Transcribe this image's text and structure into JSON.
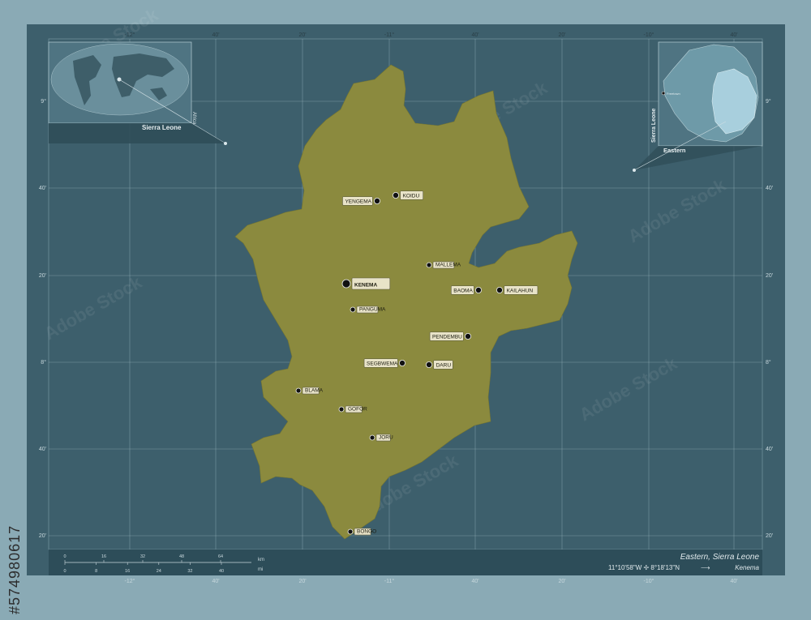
{
  "region": {
    "name": "Eastern, Sierra Leone",
    "coordinates": "11°10'58\"W ✢ 8°18'13\"N",
    "arrow": "⟶",
    "capital": "Kenema",
    "fill_color": "#8b8a3e",
    "frame_color": "#3d5f6c",
    "bg_color": "#8aaab5"
  },
  "inset_world": {
    "country_label": "Sierra Leone",
    "continent_label": "Africa"
  },
  "inset_country": {
    "country_label": "Sierra Leone",
    "region_label": "Eastern",
    "capital_label": "Freetown"
  },
  "top_ticks": [
    "-12°",
    "40'",
    "20'",
    "-11°",
    "40'",
    "20'",
    "-10°",
    "40'"
  ],
  "bottom_ticks": [
    "-12°",
    "40'",
    "20'",
    "-11°",
    "40'",
    "20'",
    "-10°",
    "40'"
  ],
  "left_ticks": [
    "9°",
    "40'",
    "20'",
    "8°",
    "40'",
    "20'"
  ],
  "right_ticks": [
    "9°",
    "40'",
    "20'",
    "8°",
    "40'",
    "20'"
  ],
  "cities": [
    {
      "name": "Kenema",
      "capital": true
    },
    {
      "name": "Koidu"
    },
    {
      "name": "Yengema"
    },
    {
      "name": "Mallema"
    },
    {
      "name": "Baoma"
    },
    {
      "name": "Kailahun"
    },
    {
      "name": "Pendembu"
    },
    {
      "name": "Segbwema"
    },
    {
      "name": "Daru"
    },
    {
      "name": "Panguma"
    },
    {
      "name": "Blama"
    },
    {
      "name": "Gofor"
    },
    {
      "name": "Joru"
    },
    {
      "name": "Bongo"
    }
  ],
  "scale": {
    "km_label": "km",
    "mi_label": "mi",
    "km_ticks": [
      "0",
      "16",
      "32",
      "48",
      "64"
    ],
    "mi_ticks_top": [
      "0",
      "8",
      "16",
      "24",
      "32",
      "40"
    ],
    "mi_ticks_bottom": [
      "0",
      "8",
      "16",
      "24",
      "32",
      "40"
    ]
  },
  "watermark": "Adobe Stock",
  "stock_id": "#574980617"
}
